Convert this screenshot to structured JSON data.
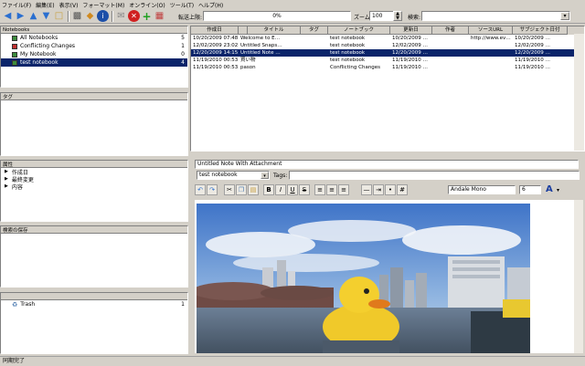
{
  "menu": [
    "ファイル(F)",
    "編集(E)",
    "表示(V)",
    "フォーマット(M)",
    "オンライン(O)",
    "ツール(T)",
    "ヘルプ(H)"
  ],
  "toolbar": {
    "progress_label": "転送上限:",
    "progress_value": "0%",
    "zoom_label": "ズーム",
    "zoom_value": "100",
    "search_label": "検索:",
    "search_value": ""
  },
  "notebooks": {
    "header": "Notebooks",
    "items": [
      {
        "label": "All Notebooks",
        "count": "5",
        "color": "#3c8c3c"
      },
      {
        "label": "Conflicting Changes",
        "count": "1",
        "color": "#c03030"
      },
      {
        "label": "My Notebook",
        "count": "0",
        "color": "#3c8c3c"
      },
      {
        "label": "test notebook",
        "count": "4",
        "color": "#3c8c3c"
      }
    ],
    "selected_index": 3
  },
  "tags": {
    "header": "タグ"
  },
  "attributes": {
    "header": "属性",
    "items": [
      "作成日",
      "最終変更",
      "内容"
    ]
  },
  "saved_searches": {
    "header": "検索の保存"
  },
  "trash": {
    "label": "Trash",
    "count": "1"
  },
  "notes_table": {
    "columns": [
      "作成日",
      "",
      "タイトル",
      "タグ",
      "ノートブック",
      "更新日",
      "作者",
      "ソースURL",
      "サブジェクト日付"
    ],
    "rows": [
      [
        "10/20/2009 07:48:37",
        "Welcome to E…",
        "",
        "test notebook",
        "10/20/2009 …",
        "",
        "http://www.ev…",
        "10/20/2009 …"
      ],
      [
        "12/02/2009 23:02:45",
        "Untitled Snaps…",
        "",
        "test notebook",
        "12/02/2009 …",
        "",
        "",
        "12/02/2009 …"
      ],
      [
        "12/20/2009 14:15:09",
        "Untitled Note …",
        "",
        "test notebook",
        "12/20/2009 …",
        "",
        "",
        "12/20/2009 …"
      ],
      [
        "11/19/2010 00:53:45",
        "買い物",
        "",
        "test notebook",
        "11/19/2010 …",
        "",
        "",
        "11/19/2010 …"
      ],
      [
        "11/19/2010 00:53:45",
        "pason",
        "",
        "Conflicting Changes",
        "11/19/2010 …",
        "",
        "",
        "11/19/2010 …"
      ]
    ],
    "selected_index": 2
  },
  "editor": {
    "note_title": "Untitled Note With Attachment",
    "notebook": "test notebook",
    "tags_label": "Tags:",
    "tags_value": "",
    "font": "Andale Mono",
    "size": "6",
    "format_buttons": [
      "B",
      "I",
      "U",
      "S"
    ]
  },
  "status": "同期完了"
}
